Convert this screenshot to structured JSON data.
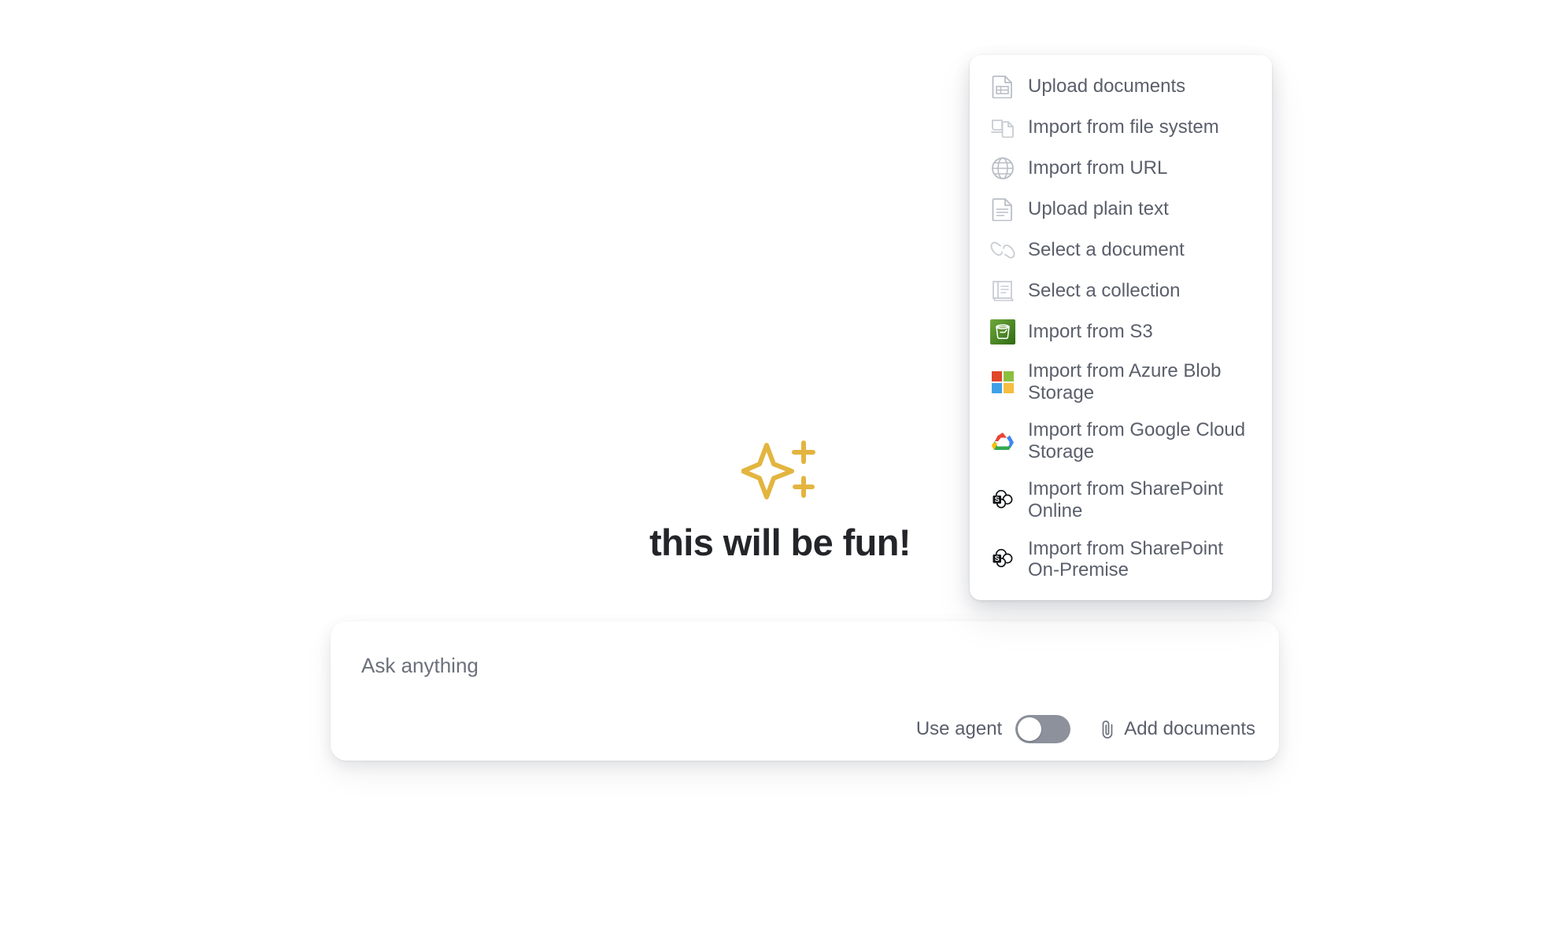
{
  "hero": {
    "icon": "sparkle-icon",
    "icon_color": "#E3B53F",
    "title": "this will be fun!"
  },
  "composer": {
    "placeholder": "Ask anything",
    "value": "",
    "use_agent_label": "Use agent",
    "use_agent_state": "off",
    "add_documents_label": "Add documents",
    "attach_icon": "paperclip-icon"
  },
  "menu": {
    "items": [
      {
        "label": "Upload documents",
        "icon": "document-table-icon"
      },
      {
        "label": "Import from file system",
        "icon": "file-system-icon"
      },
      {
        "label": "Import from URL",
        "icon": "globe-icon"
      },
      {
        "label": "Upload plain text",
        "icon": "document-text-icon"
      },
      {
        "label": "Select a document",
        "icon": "link-chain-icon"
      },
      {
        "label": "Select a collection",
        "icon": "book-collection-icon"
      },
      {
        "label": "Import from S3",
        "icon": "aws-s3-icon"
      },
      {
        "label": "Import from Azure Blob Storage",
        "icon": "microsoft-azure-icon"
      },
      {
        "label": "Import from Google Cloud Storage",
        "icon": "google-cloud-icon"
      },
      {
        "label": "Import from SharePoint Online",
        "icon": "sharepoint-icon"
      },
      {
        "label": "Import from SharePoint On-Premise",
        "icon": "sharepoint-icon"
      }
    ]
  },
  "colors": {
    "text_muted": "#5a5f6b",
    "heading": "#232529",
    "accent_yellow": "#E3B53F",
    "s3_green": "#3F7D23",
    "azure_red": "#E1452B",
    "azure_green": "#8CBF3F",
    "azure_blue": "#3FA0E8",
    "azure_yellow": "#F5BE3F",
    "toggle_track": "#8d919c",
    "background": "#ffffff"
  }
}
